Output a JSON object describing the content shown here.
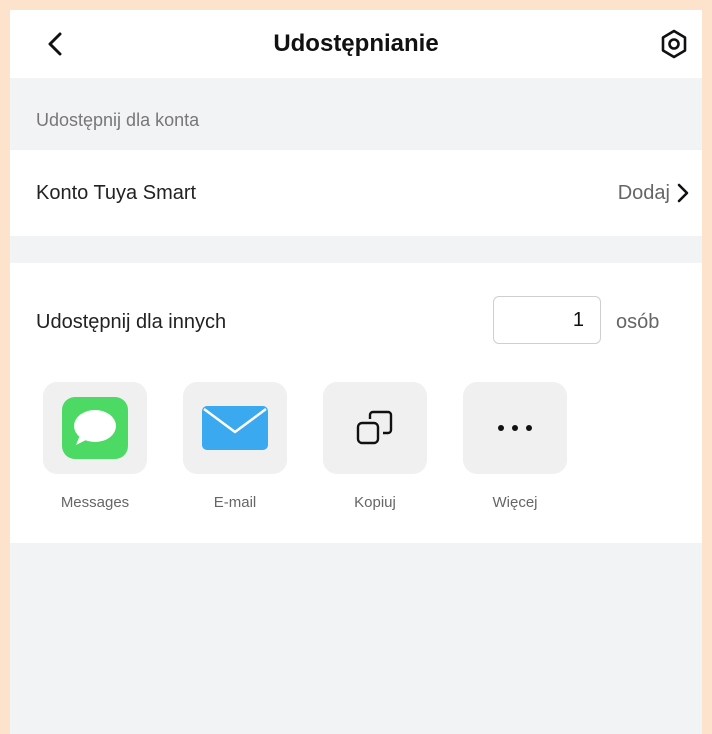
{
  "header": {
    "title": "Udostępnianie",
    "back_icon": "chevron-left-icon",
    "settings_icon": "settings-gear-icon"
  },
  "account_section": {
    "label": "Udostępnij dla konta",
    "row_label": "Konto Tuya Smart",
    "row_action": "Dodaj",
    "row_action_icon": "chevron-right-icon"
  },
  "others_section": {
    "label": "Udostępnij dla innych",
    "count_value": "1",
    "count_unit": "osób"
  },
  "apps": [
    {
      "label": "Messages",
      "icon": "messages-icon",
      "color": "#4cd964"
    },
    {
      "label": "E-mail",
      "icon": "mail-icon",
      "color": "#3aa9f0"
    },
    {
      "label": "Kopiuj",
      "icon": "copy-icon"
    },
    {
      "label": "Więcej",
      "icon": "more-icon"
    }
  ],
  "colors": {
    "background": "#f2f3f5",
    "card": "#ffffff",
    "outer_border": "#fde3cc"
  }
}
